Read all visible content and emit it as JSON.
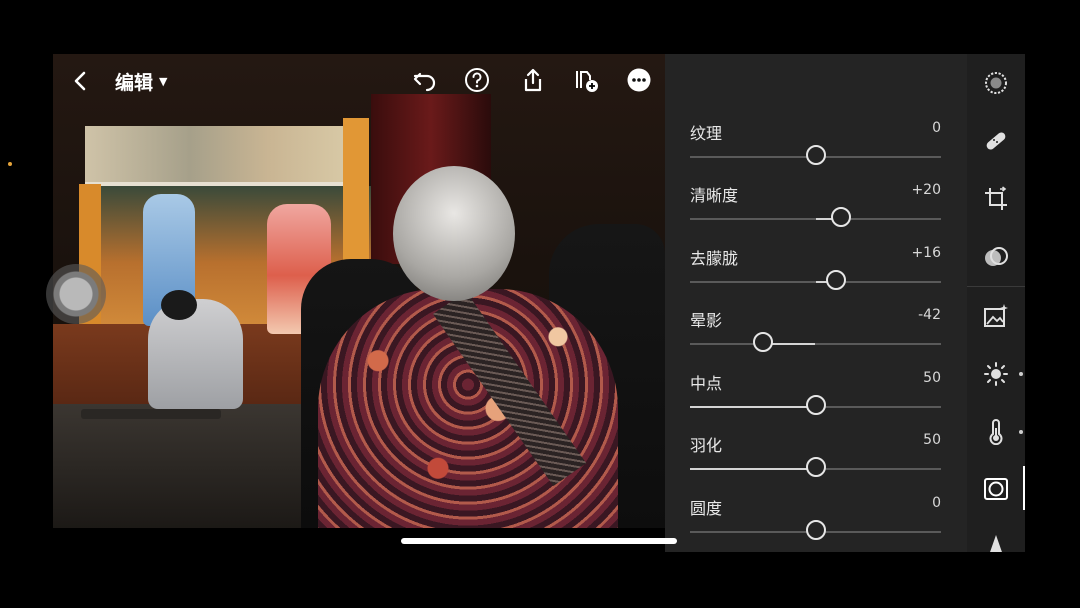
{
  "header": {
    "title": "编辑",
    "back_icon": "chevron-left-icon",
    "undo_icon": "undo-icon",
    "help_icon": "help-circle-icon",
    "share_icon": "share-icon",
    "copy_settings_icon": "copy-settings-icon",
    "more_icon": "more-icon"
  },
  "sliders": [
    {
      "label": "纹理",
      "value": "0",
      "numeric": 0
    },
    {
      "label": "清晰度",
      "value": "+20",
      "numeric": 20
    },
    {
      "label": "去朦胧",
      "value": "+16",
      "numeric": 16
    },
    {
      "label": "晕影",
      "value": "-42",
      "numeric": -42
    },
    {
      "label": "中点",
      "value": "50",
      "numeric": 50
    },
    {
      "label": "羽化",
      "value": "50",
      "numeric": 50
    },
    {
      "label": "圆度",
      "value": "0",
      "numeric": 0
    }
  ],
  "toolbar": {
    "items": [
      "selective-mask-icon",
      "healing-brush-icon",
      "crop-icon",
      "profiles-icon",
      "auto-enhance-icon",
      "light-icon",
      "color-temperature-icon",
      "vignette-effects-icon",
      "detail-triangle-icon"
    ],
    "active": "vignette-effects-icon"
  },
  "colors": {
    "panel_bg": "#242424",
    "toolbar_bg": "#1f1f1f",
    "accent": "#ffffff"
  }
}
